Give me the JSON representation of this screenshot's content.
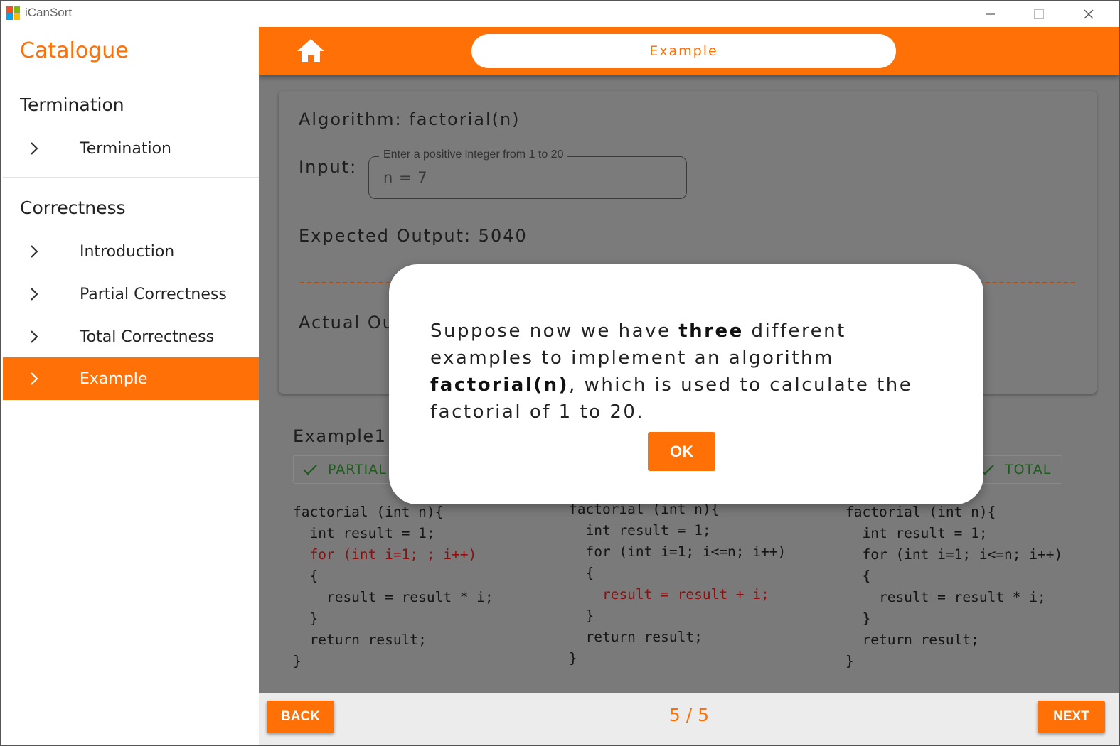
{
  "window": {
    "app_title": "iCanSort",
    "logo_colors": [
      "#f25022",
      "#7fba00",
      "#00a4ef",
      "#ffb900"
    ]
  },
  "colors": {
    "accent": "#ff7006",
    "overlay_gray": "#7a7a7a",
    "code_highlight": "#8a1010",
    "check_green": "#1f5a1f"
  },
  "sidebar": {
    "title": "Catalogue",
    "sections": [
      {
        "title": "Termination",
        "items": [
          {
            "label": "Termination",
            "active": false
          }
        ]
      },
      {
        "title": "Correctness",
        "items": [
          {
            "label": "Introduction",
            "active": false
          },
          {
            "label": "Partial Correctness",
            "active": false
          },
          {
            "label": "Total Correctness",
            "active": false
          },
          {
            "label": "Example",
            "active": true
          }
        ]
      }
    ]
  },
  "topbar": {
    "home_icon": "home-icon",
    "page_title": "Example"
  },
  "card": {
    "algorithm": "Algorithm: factorial(n)",
    "input_label": "Input:",
    "input_legend": "Enter a positive integer from 1 to 20",
    "input_value": "n = 7",
    "expected_output": "Expected Output: 5040",
    "actual_output_partial": "Actual Ou"
  },
  "examples": {
    "title": "Example1",
    "chips": [
      {
        "label": "PARTIAL",
        "icon": "check-icon"
      },
      {
        "label": "TOTAL",
        "icon": "check-icon"
      }
    ],
    "code_blocks": [
      {
        "lines": [
          {
            "text": "factorial (int n){",
            "highlight": false
          },
          {
            "text": "  int result = 1;",
            "highlight": false
          },
          {
            "text": "  for (int i=1; ; i++)",
            "highlight": true
          },
          {
            "text": "  {",
            "highlight": false
          },
          {
            "text": "    result = result * i;",
            "highlight": false
          },
          {
            "text": "  }",
            "highlight": false
          },
          {
            "text": "  return result;",
            "highlight": false
          },
          {
            "text": "}",
            "highlight": false
          }
        ]
      },
      {
        "lines": [
          {
            "text": "factorial (int n){",
            "highlight": false
          },
          {
            "text": "  int result = 1;",
            "highlight": false
          },
          {
            "text": "  for (int i=1; i<=n; i++)",
            "highlight": false
          },
          {
            "text": "  {",
            "highlight": false
          },
          {
            "text": "    result = result + i;",
            "highlight": true
          },
          {
            "text": "  }",
            "highlight": false
          },
          {
            "text": "  return result;",
            "highlight": false
          },
          {
            "text": "}",
            "highlight": false
          }
        ]
      },
      {
        "lines": [
          {
            "text": "factorial (int n){",
            "highlight": false
          },
          {
            "text": "  int result = 1;",
            "highlight": false
          },
          {
            "text": "  for (int i=1; i<=n; i++)",
            "highlight": false
          },
          {
            "text": "  {",
            "highlight": false
          },
          {
            "text": "    result = result * i;",
            "highlight": false
          },
          {
            "text": "  }",
            "highlight": false
          },
          {
            "text": "  return result;",
            "highlight": false
          },
          {
            "text": "}",
            "highlight": false
          }
        ]
      }
    ]
  },
  "bottombar": {
    "back_label": "BACK",
    "page_counter": "5 / 5",
    "next_label": "NEXT"
  },
  "modal": {
    "segments": [
      {
        "text": "Suppose now we have ",
        "bold": false
      },
      {
        "text": "three",
        "bold": true
      },
      {
        "text": " different examples to implement an algorithm ",
        "bold": false
      },
      {
        "text": "factorial(n)",
        "bold": true
      },
      {
        "text": ", which is used to calculate the factorial of 1 to 20.",
        "bold": false
      }
    ],
    "ok_label": "OK"
  }
}
